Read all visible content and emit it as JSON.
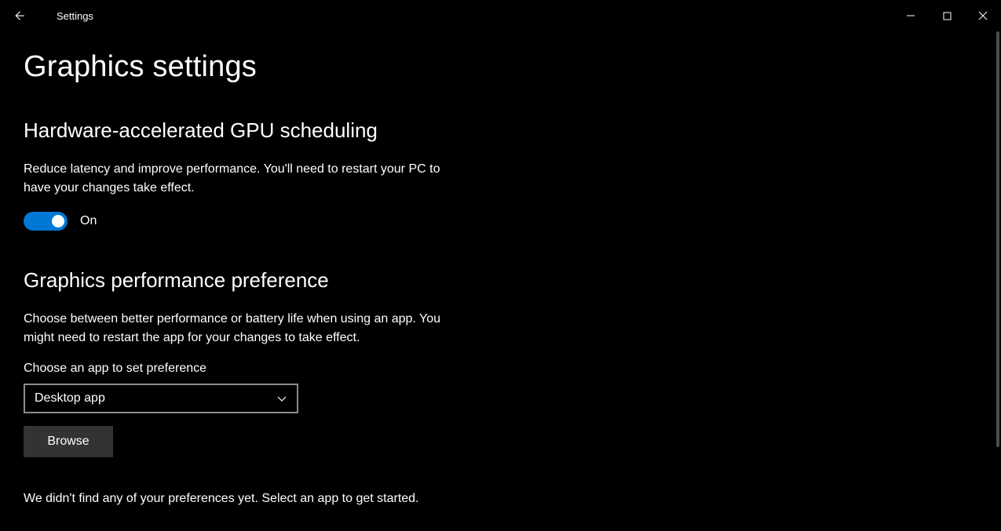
{
  "window": {
    "app_title": "Settings"
  },
  "page": {
    "title": "Graphics settings"
  },
  "gpu_sched": {
    "heading": "Hardware-accelerated GPU scheduling",
    "description": "Reduce latency and improve performance. You'll need to restart your PC to have your changes take effect.",
    "toggle_state_label": "On"
  },
  "perf_pref": {
    "heading": "Graphics performance preference",
    "description": "Choose between better performance or battery life when using an app. You might need to restart the app for your changes to take effect.",
    "field_label": "Choose an app to set preference",
    "dropdown_selected": "Desktop app",
    "browse_label": "Browse",
    "empty_message": "We didn't find any of your preferences yet. Select an app to get started."
  },
  "colors": {
    "accent": "#0078d4"
  }
}
